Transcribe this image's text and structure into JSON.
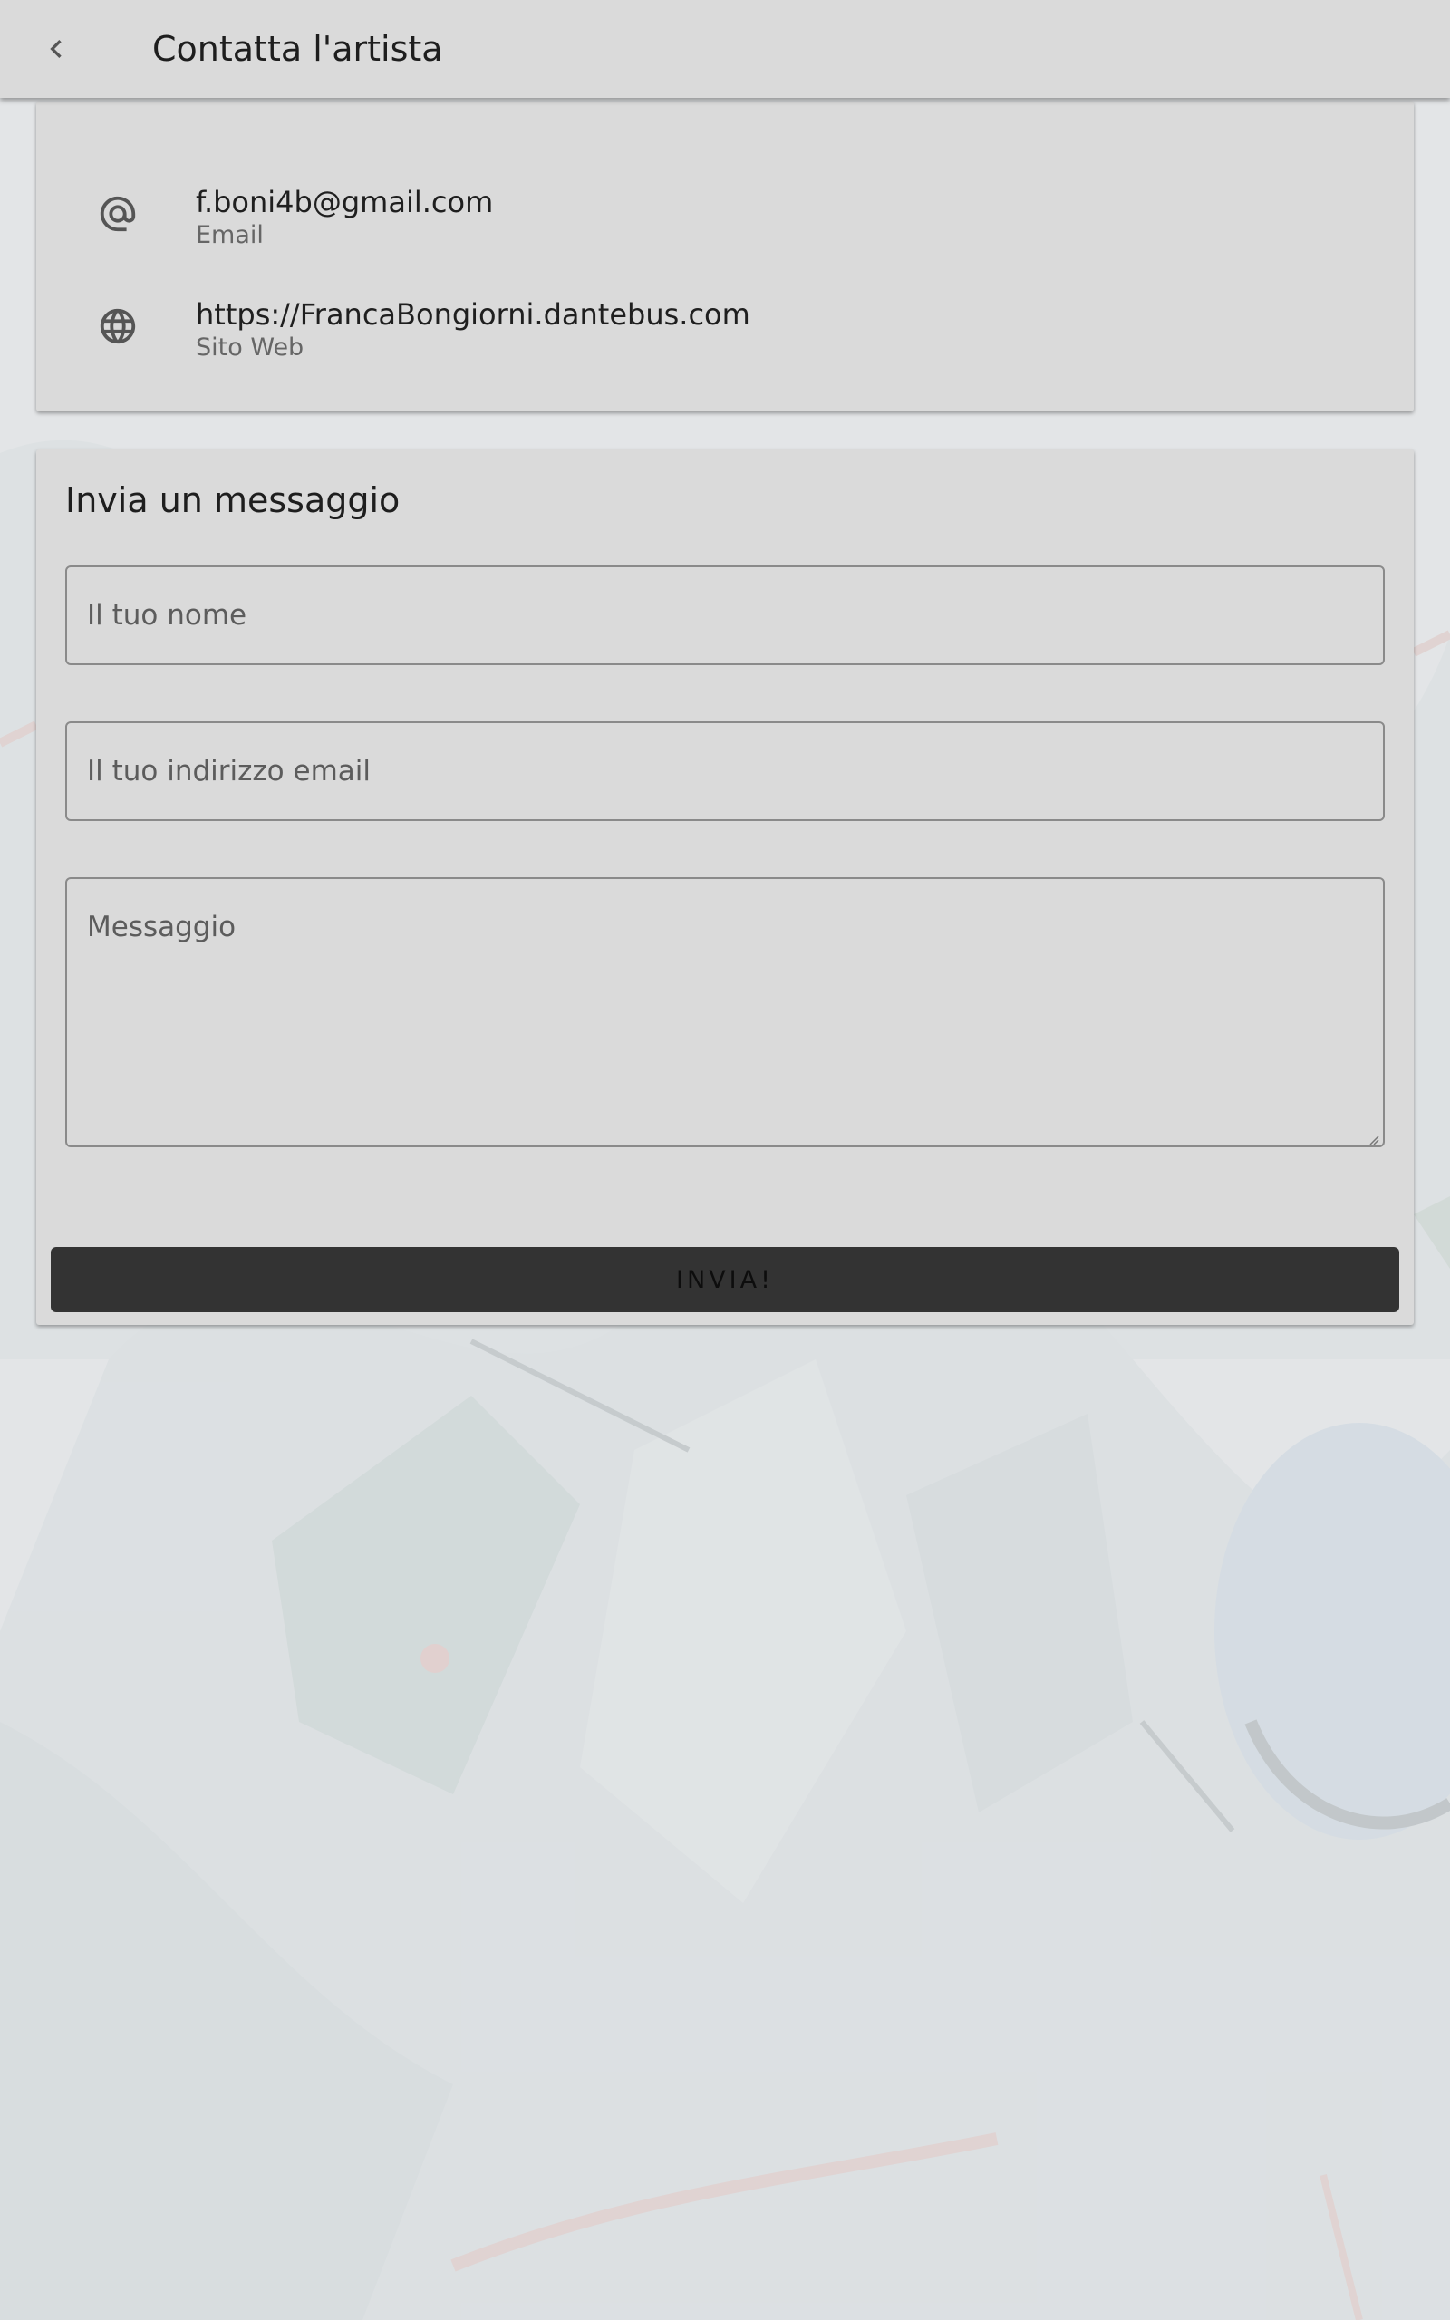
{
  "appbar": {
    "title": "Contatta l'artista",
    "back_icon": "chevron-left-icon"
  },
  "contact_info": {
    "items": [
      {
        "icon": "at-sign-icon",
        "value": "f.boni4b@gmail.com",
        "label": "Email"
      },
      {
        "icon": "globe-icon",
        "value": "https://FrancaBongiorni.dantebus.com",
        "label": "Sito Web"
      }
    ]
  },
  "message_form": {
    "title": "Invia un messaggio",
    "name_placeholder": "Il tuo nome",
    "email_placeholder": "Il tuo indirizzo email",
    "message_placeholder": "Messaggio",
    "submit_label": "INVIA!"
  },
  "colors": {
    "appbar": "#dadada",
    "card": "#dadada",
    "button": "#333333",
    "text": "#1e1e1e",
    "secondary_text": "#666666"
  }
}
